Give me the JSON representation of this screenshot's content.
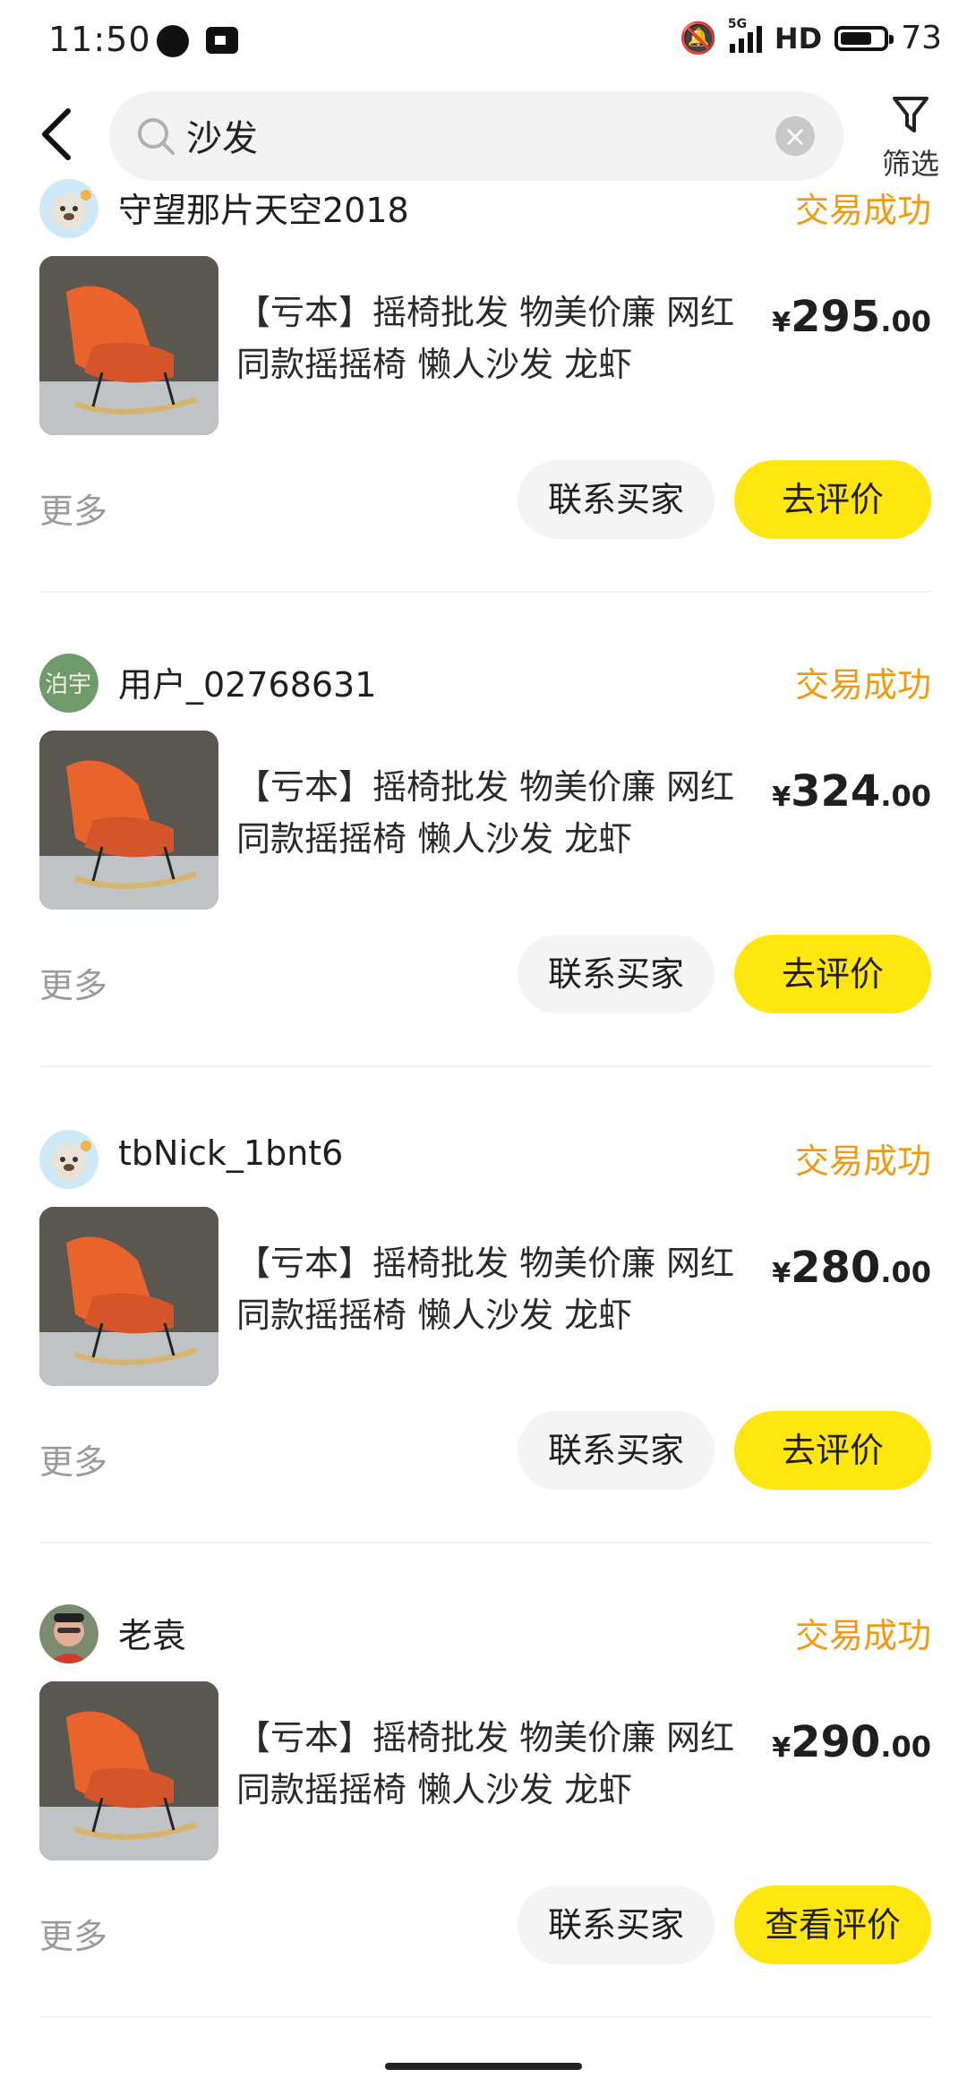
{
  "status_bar": {
    "time": "11:50",
    "signal_label": "5G",
    "hd": "HD",
    "battery": "73",
    "battery_level_percent": 73
  },
  "search": {
    "query": "沙发",
    "filter_label": "筛选"
  },
  "colors": {
    "accent_yellow": "#ffe60f",
    "status_orange": "#f09a12"
  },
  "orders": [
    {
      "user": "守望那片天空2018",
      "status": "交易成功",
      "title": "【亏本】摇椅批发 物美价廉 网红同款摇摇椅 懒人沙发 龙虾",
      "currency": "¥",
      "price_int": "295",
      "price_dec": ".00",
      "more": "更多",
      "contact_label": "联系买家",
      "rate_label": "去评价"
    },
    {
      "user": "用户_02768631",
      "status": "交易成功",
      "title": "【亏本】摇椅批发 物美价廉 网红同款摇摇椅 懒人沙发 龙虾",
      "currency": "¥",
      "price_int": "324",
      "price_dec": ".00",
      "more": "更多",
      "contact_label": "联系买家",
      "rate_label": "去评价",
      "avatar_text": "泊宇"
    },
    {
      "user": "tbNick_1bnt6",
      "status": "交易成功",
      "title": "【亏本】摇椅批发 物美价廉 网红同款摇摇椅 懒人沙发 龙虾",
      "currency": "¥",
      "price_int": "280",
      "price_dec": ".00",
      "more": "更多",
      "contact_label": "联系买家",
      "rate_label": "去评价"
    },
    {
      "user": "老袁",
      "status": "交易成功",
      "title": "【亏本】摇椅批发 物美价廉 网红同款摇摇椅 懒人沙发 龙虾",
      "currency": "¥",
      "price_int": "290",
      "price_dec": ".00",
      "more": "更多",
      "contact_label": "联系买家",
      "rate_label": "查看评价"
    }
  ]
}
